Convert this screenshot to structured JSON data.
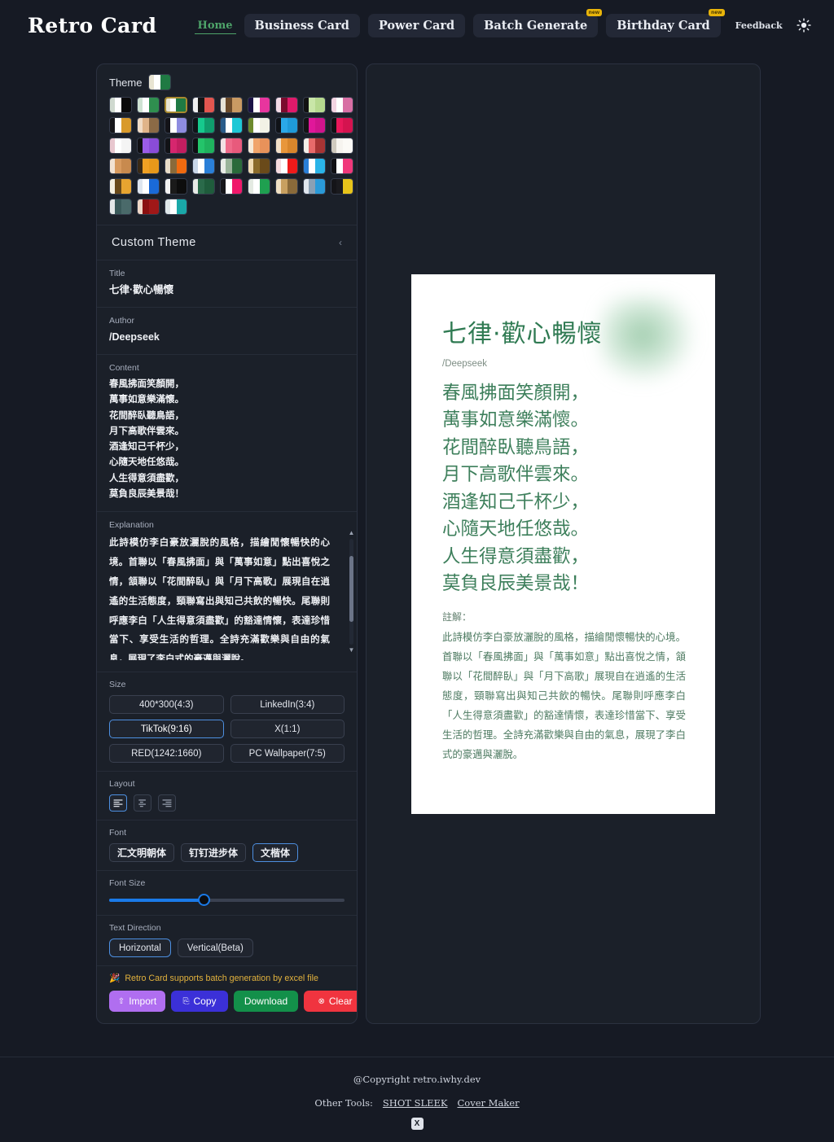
{
  "header": {
    "brand": "Retro Card",
    "nav": [
      {
        "label": "Home",
        "active": true,
        "badge": ""
      },
      {
        "label": "Business Card",
        "active": false,
        "badge": ""
      },
      {
        "label": "Power Card",
        "active": false,
        "badge": ""
      },
      {
        "label": "Batch Generate",
        "active": false,
        "badge": "new"
      },
      {
        "label": "Birthday Card",
        "active": false,
        "badge": "new"
      },
      {
        "label": "Feedback",
        "active": false,
        "badge": ""
      }
    ],
    "theme_toggle_icon": "sun-icon"
  },
  "sidebar": {
    "theme_label": "Theme",
    "selected_theme_index": 2,
    "themes": [
      [
        "#cfd9cf",
        "#ffffff",
        "#0a0a0a"
      ],
      [
        "#cfe3d3",
        "#ffffff",
        "#2f8f4f"
      ],
      [
        "#e8e4d2",
        "#ffffff",
        "#1f7a43"
      ],
      [
        "#f0f0f0",
        "#151515",
        "#e2564f"
      ],
      [
        "#e6e2d6",
        "#6b4a2a",
        "#c99a63"
      ],
      [
        "#1b1246",
        "#ffffff",
        "#e8359e"
      ],
      [
        "#f3dbe6",
        "#7a0b2e",
        "#e01a6a"
      ],
      [
        "#121212",
        "#c9e6a8",
        "#b6d98f"
      ],
      [
        "#f3d4e2",
        "#ffffff",
        "#d86fa4"
      ],
      [
        "#16161a",
        "#ffffff",
        "#d99a2b"
      ],
      [
        "#f0dcc6",
        "#e0b489",
        "#8b6a46"
      ],
      [
        "#131318",
        "#ffffff",
        "#8e8ce0"
      ],
      [
        "#0f1418",
        "#16c98d",
        "#0f9c6c"
      ],
      [
        "#2a5c8a",
        "#ffffff",
        "#1ec8d6"
      ],
      [
        "#6d8a2e",
        "#ffffff",
        "#f2f2e6"
      ],
      [
        "#101318",
        "#2aa8e8",
        "#1f9ad8"
      ],
      [
        "#141414",
        "#e0179a",
        "#d0148c"
      ],
      [
        "#111115",
        "#e8185a",
        "#d4134f"
      ],
      [
        "#e8c7cf",
        "#ffffff",
        "#f4f4f4"
      ],
      [
        "#101014",
        "#9b5ce8",
        "#8a4cd8"
      ],
      [
        "#121216",
        "#d6266e",
        "#c21e60"
      ],
      [
        "#0f0f13",
        "#24c46a",
        "#1fb25e"
      ],
      [
        "#f3e0e4",
        "#ef6a8a",
        "#e85a7c"
      ],
      [
        "#f6ead8",
        "#f0a46a",
        "#e8925a"
      ],
      [
        "#f2e0c8",
        "#e8963a",
        "#d8862c"
      ],
      [
        "#f3efe8",
        "#e86a6a",
        "#a83434"
      ],
      [
        "#cfcabf",
        "#f6f4ef",
        "#fbfaf6"
      ],
      [
        "#f2e2d2",
        "#d89a5e",
        "#c88a4e"
      ],
      [
        "#3a2a16",
        "#f0a023",
        "#e8981a"
      ],
      [
        "#e8dcc8",
        "#8a6a3a",
        "#f06a10"
      ],
      [
        "#c8d6e8",
        "#ffffff",
        "#2a7fd8"
      ],
      [
        "#e8ece6",
        "#9ab49a",
        "#2a6a3a"
      ],
      [
        "#f0dcb4",
        "#8a6a2a",
        "#6a4a1a"
      ],
      [
        "#f6dce0",
        "#ffffff",
        "#ef1a1a"
      ],
      [
        "#2a7fd8",
        "#ffffff",
        "#2ab4e8"
      ],
      [
        "#101014",
        "#ffffff",
        "#f0387a"
      ],
      [
        "#f6f0e0",
        "#6a4a1a",
        "#e8a430"
      ],
      [
        "#dfe6ef",
        "#ffffff",
        "#1a6ad8"
      ],
      [
        "#f2f2f2",
        "#1a1a1a",
        "#0d0d0d"
      ],
      [
        "#e8eae6",
        "#2a6a4a",
        "#1f5c3c"
      ],
      [
        "#151519",
        "#ffffff",
        "#f0186a"
      ],
      [
        "#e4eae2",
        "#ffffff",
        "#1fa050"
      ],
      [
        "#f0e0c4",
        "#c8a060",
        "#8a6a3a"
      ],
      [
        "#e0e6ee",
        "#8aa0b4",
        "#2a9ad8"
      ],
      [
        "#141418",
        "#1a1a1e",
        "#e8c41a"
      ],
      [
        "#e4e8e8",
        "#3a5a5a",
        "#4a6a6a"
      ],
      [
        "#f0d8c8",
        "#8a1010",
        "#a01818"
      ],
      [
        "#dfe8ea",
        "#ffffff",
        "#1aa8a8"
      ]
    ],
    "custom_theme_label": "Custom Theme",
    "custom_theme_chevron": "chevron-left-icon",
    "title_label": "Title",
    "title_value": "七律·歡心暢懷",
    "author_label": "Author",
    "author_value": "/Deepseek",
    "content_label": "Content",
    "content_value": "春風拂面笑顏開，\n萬事如意樂滿懷。\n花間醉臥聽鳥語，\n月下高歌伴雲來。\n酒逢知己千杯少，\n心隨天地任悠哉。\n人生得意須盡歡，\n莫負良辰美景哉！",
    "explanation_label": "Explanation",
    "explanation_value": "此詩模仿李白豪放灑脫的風格，描繪閒懷暢快的心境。首聯以「春風拂面」與「萬事如意」點出喜悅之情，頷聯以「花間醉臥」與「月下高歌」展現自在逍遙的生活態度，頸聯寫出與知己共飲的暢快。尾聯則呼應李白「人生得意須盡歡」的豁達情懷，表達珍惜當下、享受生活的哲理。全詩充滿歡樂與自由的氣息，展現了李白式的豪邁與灑脫。",
    "size_label": "Size",
    "sizes": [
      {
        "label": "400*300(4:3)",
        "selected": false
      },
      {
        "label": "LinkedIn(3:4)",
        "selected": false
      },
      {
        "label": "TikTok(9:16)",
        "selected": true
      },
      {
        "label": "X(1:1)",
        "selected": false
      },
      {
        "label": "RED(1242:1660)",
        "selected": false
      },
      {
        "label": "PC Wallpaper(7:5)",
        "selected": false
      }
    ],
    "layout_label": "Layout",
    "layouts": [
      {
        "name": "align-left-icon",
        "selected": true
      },
      {
        "name": "align-center-icon",
        "selected": false
      },
      {
        "name": "align-right-icon",
        "selected": false
      }
    ],
    "font_label": "Font",
    "fonts": [
      {
        "label": "汇文明朝体",
        "selected": false
      },
      {
        "label": "钉钉进步体",
        "selected": false
      },
      {
        "label": "文楷体",
        "selected": true
      }
    ],
    "font_size_label": "Font Size",
    "font_size_percent": 40,
    "text_direction_label": "Text Direction",
    "directions": [
      {
        "label": "Horizontal",
        "selected": true
      },
      {
        "label": "Vertical(Beta)",
        "selected": false
      }
    ],
    "notice_icon": "party-popper-icon",
    "notice_text": "Retro Card supports batch generation by excel file",
    "actions": [
      {
        "label": "Import",
        "icon": "upload-icon",
        "color": "#b06ef0"
      },
      {
        "label": "Copy",
        "icon": "clipboard-icon",
        "color": "#3b30d8"
      },
      {
        "label": "Download",
        "icon": "",
        "color": "#13904a"
      },
      {
        "label": "Clear",
        "icon": "circle-x-icon",
        "color": "#f0343f"
      }
    ]
  },
  "card": {
    "title": "七律·歡心暢懷",
    "author": "/Deepseek",
    "poem": "春風拂面笑顏開，\n萬事如意樂滿懷。\n花間醉臥聽鳥語，\n月下高歌伴雲來。\n酒逢知己千杯少，\n心隨天地任悠哉。\n人生得意須盡歡，\n莫負良辰美景哉！",
    "note_label": "註解：",
    "note": "此詩模仿李白豪放灑脫的風格，描繪閒懷暢快的心境。首聯以「春風拂面」與「萬事如意」點出喜悅之情，頷聯以「花間醉臥」與「月下高歌」展現自在逍遙的生活態度，頸聯寫出與知己共飲的暢快。尾聯則呼應李白「人生得意須盡歡」的豁達情懷，表達珍惜當下、享受生活的哲理。全詩充滿歡樂與自由的氣息，展現了李白式的豪邁與灑脫。",
    "accent_color": "#2f7a52"
  },
  "footer": {
    "copyright": "@Copyright retro.iwhy.dev",
    "other_tools_label": "Other Tools:",
    "links": [
      "SHOT SLEEK",
      "Cover Maker"
    ],
    "x_label": "X"
  }
}
